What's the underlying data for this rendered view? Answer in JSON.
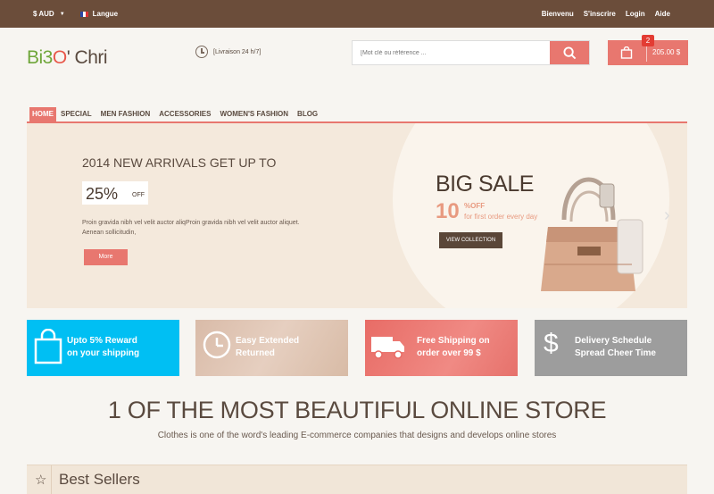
{
  "topbar": {
    "currency": "$ AUD",
    "language": "Langue",
    "links": [
      "Bienvenu",
      "S'inscrire",
      "Login",
      "Aide"
    ]
  },
  "header": {
    "logo": {
      "part1": "Bi3",
      "part2": "O",
      "part3": "' Chri"
    },
    "delivery": "[Livraison 24 h/7]",
    "search_placeholder": "[Mot clé ou référence ...",
    "cart_total": "205.00 $",
    "cart_count": "2"
  },
  "nav": [
    "HOME",
    "SPECIAL",
    "MEN FASHION",
    "ACCESSORIES",
    "WOMEN'S FASHION",
    "BLOG"
  ],
  "hero": {
    "headline": "2014 NEW ARRIVALS GET UP TO",
    "percent": "25%",
    "off": "OFF",
    "description": "Proin gravida nibh vel velit auctor aliqProin gravida nibh vel velit auctor aliquet. Aenean sollicitudin,",
    "more": "More",
    "big_sale": "BIG SALE",
    "ten": "10",
    "pct_off": "%OFF",
    "first_order": "for first order every day",
    "view_collection": "VIEW COLLECTION"
  },
  "features": [
    {
      "line1": "Upto 5% Reward",
      "line2": "on your shipping",
      "icon": "shopping-bag-icon",
      "color": "#00bff3"
    },
    {
      "line1": "Easy Extended",
      "line2": "Returned",
      "icon": "clock-icon",
      "color": "#d9bba8"
    },
    {
      "line1": "Free Shipping on",
      "line2": "order over 99 $",
      "icon": "truck-icon",
      "color": "#e86c66"
    },
    {
      "line1": "Delivery Schedule",
      "line2": "Spread Cheer Time",
      "icon": "dollar-icon",
      "color": "#9d9d9d"
    }
  ],
  "headline": "1 OF THE MOST BEAUTIFUL ONLINE STORE",
  "subline": "Clothes is one of the word's leading E-commerce companies that designs and develops online stores",
  "best_sellers": "Best Sellers",
  "colors": {
    "brand_brown": "#6b4d3a",
    "accent_coral": "#e8776f"
  }
}
